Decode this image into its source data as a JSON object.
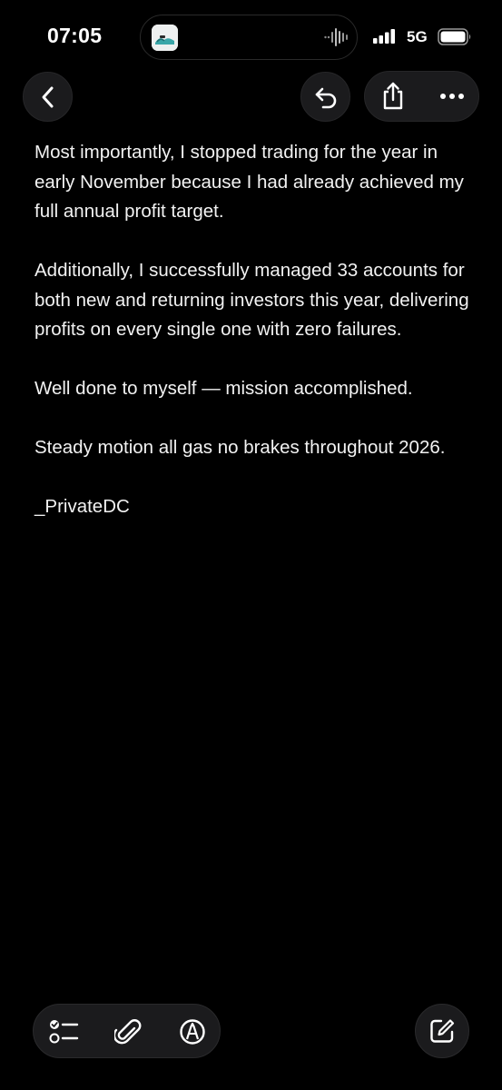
{
  "status_bar": {
    "time": "07:05",
    "network": "5G"
  },
  "header": {
    "back_icon": "chevron-left-icon",
    "reply_icon": "undo-arrow-icon",
    "share_icon": "share-icon",
    "more_icon": "ellipsis-icon"
  },
  "note": {
    "paragraphs": [
      "Most importantly, I stopped trading for the year in early November because I had already achieved my full annual profit target.",
      "Additionally, I successfully managed 33 accounts for both new and returning investors this year, delivering profits on every single one with zero failures.",
      "Well done to myself — mission accomplished.",
      "Steady motion all gas no brakes throughout 2026.",
      "_PrivateDC"
    ]
  },
  "toolbar": {
    "checklist_icon": "checklist-icon",
    "attach_icon": "paperclip-icon",
    "markup_icon": "markup-pen-icon",
    "compose_icon": "compose-icon"
  },
  "colors": {
    "background": "#000000",
    "button_bg": "#1b1b1d",
    "text": "#f2f2f2"
  }
}
